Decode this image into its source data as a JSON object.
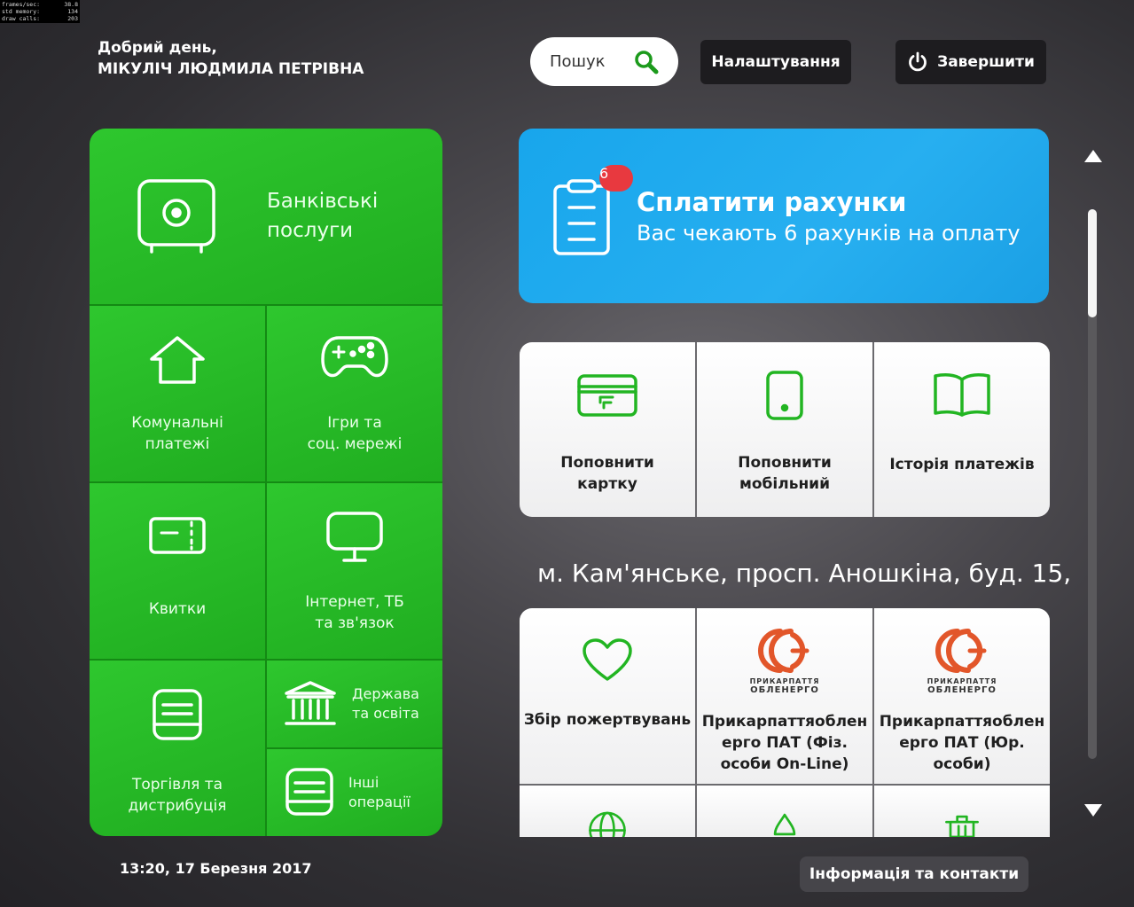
{
  "debug": {
    "rows": [
      {
        "label": "frames/sec:",
        "value": "38.8"
      },
      {
        "label": "std memory:",
        "value": "134"
      },
      {
        "label": "draw calls:",
        "value": "203"
      }
    ]
  },
  "header": {
    "greeting": "Добрий день,",
    "user_name": "МІКУЛІЧ ЛЮДМИЛА ПЕТРІВНА",
    "search_label": "Пошук",
    "settings_label": "Налаштування",
    "logout_label": "Завершити"
  },
  "categories": {
    "bank": "Банківські\nпослуги",
    "utilities": "Комунальні\nплатежі",
    "games": "Ігри та\nсоц. мережі",
    "tickets": "Квитки",
    "internet": "Інтернет, ТБ\nта зв'язок",
    "trade": "Торгівля та\nдистрибуція",
    "state": "Держава\nта освіта",
    "other": "Інші\nоперації"
  },
  "bills": {
    "badge": "6",
    "title": "Сплатити рахунки",
    "subtitle": "Вас чекають 6 рахунків на оплату"
  },
  "quick_actions": [
    {
      "label": "Поповнити\nкартку",
      "icon": "card-icon"
    },
    {
      "label": "Поповнити\nмобільний",
      "icon": "mobile-icon"
    },
    {
      "label": "Історія платежів",
      "icon": "book-icon"
    }
  ],
  "address": "м. Кам'янське, просп. Аношкіна, буд. 15,",
  "providers": [
    {
      "label": "Збір пожертвувань",
      "icon": "heart-icon"
    },
    {
      "label": "Прикарпаттяоблен\nерго ПАТ (Фіз.\nособи On-Line)",
      "icon": "oblenergo-logo",
      "logo_text_1": "ПРИКАРПАТТЯ",
      "logo_text_2": "ОБЛЕНЕРГО"
    },
    {
      "label": "Прикарпаттяоблен\nерго ПАТ (Юр.\nособи)",
      "icon": "oblenergo-logo",
      "logo_text_1": "ПРИКАРПАТТЯ",
      "logo_text_2": "ОБЛЕНЕРГО"
    }
  ],
  "footer": {
    "datetime": "13:20,  17 Березня 2017",
    "info_label": "Інформація та контакти"
  },
  "colors": {
    "green": "#22b522",
    "blue": "#18a6ec",
    "badge_red": "#e8393f",
    "oblenergo_orange": "#e2562a"
  }
}
